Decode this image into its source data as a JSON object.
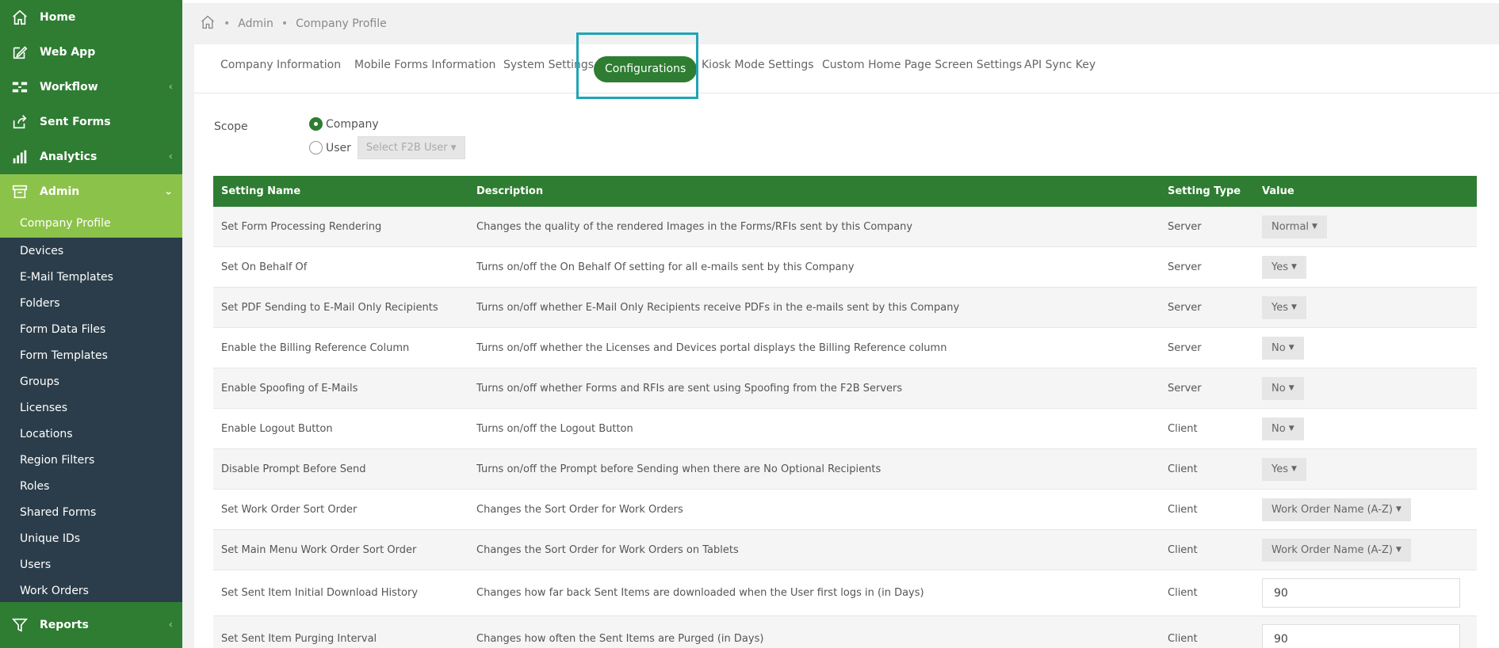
{
  "sidebar": {
    "items": [
      {
        "label": "Home",
        "icon": "home-icon"
      },
      {
        "label": "Web App",
        "icon": "edit-icon"
      },
      {
        "label": "Workflow",
        "icon": "workflow-icon"
      },
      {
        "label": "Sent Forms",
        "icon": "share-icon"
      },
      {
        "label": "Analytics",
        "icon": "bar-chart-icon"
      },
      {
        "label": "Admin",
        "icon": "archive-icon"
      }
    ],
    "chevron_collapsed": "‹",
    "chevron_expanded": "⌄",
    "sub_items": [
      "Company Profile",
      "Devices",
      "E-Mail Templates",
      "Folders",
      "Form Data Files",
      "Form Templates",
      "Groups",
      "Licenses",
      "Locations",
      "Region Filters",
      "Roles",
      "Shared Forms",
      "Unique IDs",
      "Users",
      "Work Orders"
    ],
    "reports": {
      "label": "Reports",
      "icon": "filter-icon"
    }
  },
  "breadcrumb": {
    "separator": "•",
    "items": [
      "Admin",
      "Company Profile"
    ]
  },
  "tabs": [
    "Company Information",
    "Mobile Forms Information",
    "System Settings",
    "Configurations",
    "Kiosk Mode Settings",
    "Custom Home Page Screen Settings",
    "API Sync Key"
  ],
  "scope": {
    "label": "Scope",
    "company": "Company",
    "user": "User",
    "user_select": "Select F2B User"
  },
  "table": {
    "headers": [
      "Setting Name",
      "Description",
      "Setting Type",
      "Value"
    ],
    "rows": [
      {
        "name": "Set Form Processing Rendering",
        "desc": "Changes the quality of the rendered Images in the Forms/RFIs sent by this Company",
        "type": "Server",
        "value": "Normal"
      },
      {
        "name": "Set On Behalf Of",
        "desc": "Turns on/off the On Behalf Of setting for all e-mails sent by this Company",
        "type": "Server",
        "value": "Yes"
      },
      {
        "name": "Set PDF Sending to E-Mail Only Recipients",
        "desc": "Turns on/off whether E-Mail Only Recipients receive PDFs in the e-mails sent by this Company",
        "type": "Server",
        "value": "Yes"
      },
      {
        "name": "Enable the Billing Reference Column",
        "desc": "Turns on/off whether the Licenses and Devices portal displays the Billing Reference column",
        "type": "Server",
        "value": "No"
      },
      {
        "name": "Enable Spoofing of E-Mails",
        "desc": "Turns on/off whether Forms and RFIs are sent using Spoofing from the F2B Servers",
        "type": "Server",
        "value": "No"
      },
      {
        "name": "Enable Logout Button",
        "desc": "Turns on/off the Logout Button",
        "type": "Client",
        "value": "No"
      },
      {
        "name": "Disable Prompt Before Send",
        "desc": "Turns on/off the Prompt before Sending when there are No Optional Recipients",
        "type": "Client",
        "value": "Yes"
      },
      {
        "name": "Set Work Order Sort Order",
        "desc": "Changes the Sort Order for Work Orders",
        "type": "Client",
        "value": "Work Order Name (A-Z)"
      },
      {
        "name": "Set Main Menu Work Order Sort Order",
        "desc": "Changes the Sort Order for Work Orders on Tablets",
        "type": "Client",
        "value": "Work Order Name (A-Z)"
      },
      {
        "name": "Set Sent Item Initial Download History",
        "desc": "Changes how far back Sent Items are downloaded when the User first logs in (in Days)",
        "type": "Client",
        "value": "90"
      },
      {
        "name": "Set Sent Item Purging Interval",
        "desc": "Changes how often the Sent Items are Purged (in Days)",
        "type": "Client",
        "value": "90"
      }
    ]
  },
  "colors": {
    "green": "#2e7d32",
    "lightgreen": "#8bc34a",
    "sidebar": "#2b3d4a",
    "highlight": "#1fa5b5"
  }
}
